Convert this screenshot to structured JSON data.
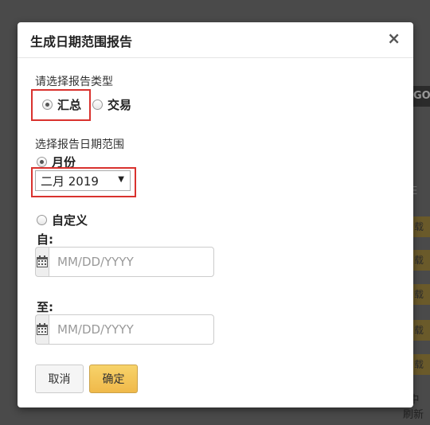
{
  "background": {
    "go_label": "GO",
    "side_label": "E",
    "button_labels": [
      "载",
      "载",
      "载",
      "载",
      "载"
    ],
    "bottom_text_1": "F中",
    "bottom_text_2": "刷新"
  },
  "dialog": {
    "title": "生成日期范围报告",
    "close_label": "×",
    "report_type": {
      "label": "请选择报告类型",
      "options": [
        {
          "label": "汇总",
          "checked": true
        },
        {
          "label": "交易",
          "checked": false
        }
      ]
    },
    "date_range": {
      "label": "选择报告日期范围",
      "month_option": {
        "label": "月份",
        "checked": true
      },
      "month_select_value": "二月 2019",
      "custom_option": {
        "label": "自定义",
        "checked": false
      },
      "from_label": "自:",
      "from_placeholder": "MM/DD/YYYY",
      "to_label": "至:",
      "to_placeholder": "MM/DD/YYYY"
    },
    "buttons": {
      "cancel": "取消",
      "ok": "确定"
    },
    "highlight_color": "#d9322e",
    "ok_button_color": "#f0b94a"
  }
}
